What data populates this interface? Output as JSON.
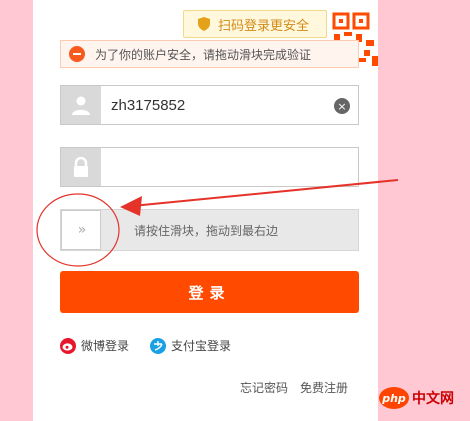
{
  "qr_tip": {
    "text": "扫码登录更安全",
    "icon": "shield-icon"
  },
  "warning": {
    "text": "为了你的账户安全，请拖动滑块完成验证",
    "icon": "minus-circle-icon"
  },
  "username": {
    "value": "zh3175852",
    "icon": "user-icon",
    "clear_icon": "clear-icon"
  },
  "password": {
    "value": "",
    "icon": "lock-icon"
  },
  "slider": {
    "hint": "请按住滑块，拖动到最右边",
    "knob": "»"
  },
  "login_button": {
    "label": "登录"
  },
  "social": {
    "weibo": {
      "label": "微博登录",
      "icon": "weibo-icon"
    },
    "alipay": {
      "label": "支付宝登录",
      "icon": "alipay-icon"
    }
  },
  "links": {
    "forgot": "忘记密码",
    "register": "免费注册"
  },
  "watermark": {
    "logo": "php",
    "text": "中文网"
  },
  "colors": {
    "accent": "#ff4a00",
    "background": "#ffc8d3",
    "annotation": "#e5332a"
  }
}
